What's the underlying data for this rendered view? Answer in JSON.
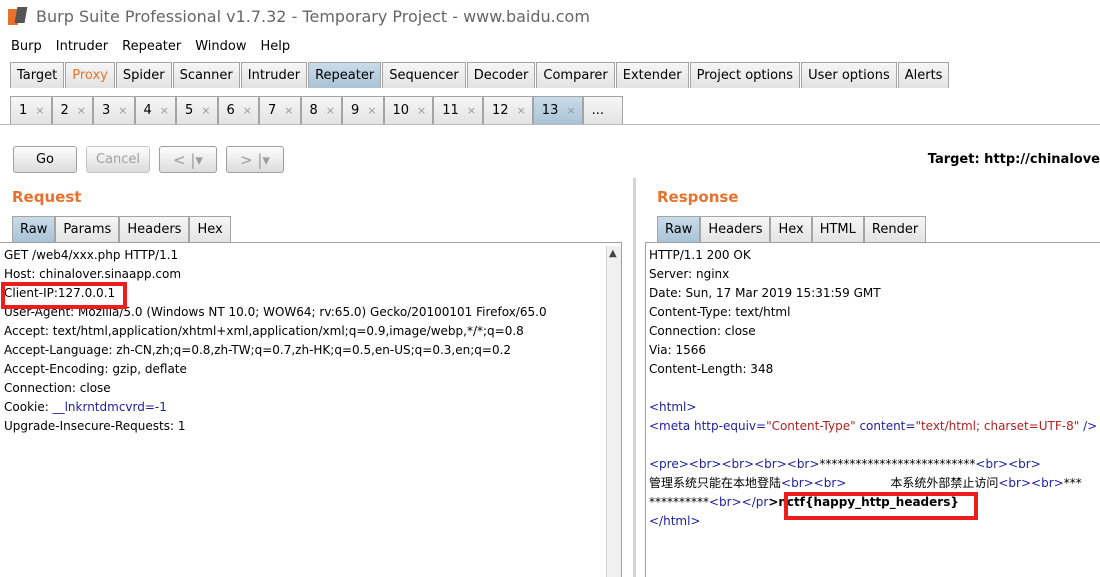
{
  "window": {
    "title": "Burp Suite Professional v1.7.32 - Temporary Project - www.baidu.com"
  },
  "menu": [
    "Burp",
    "Intruder",
    "Repeater",
    "Window",
    "Help"
  ],
  "main_tabs": [
    "Target",
    "Proxy",
    "Spider",
    "Scanner",
    "Intruder",
    "Repeater",
    "Sequencer",
    "Decoder",
    "Comparer",
    "Extender",
    "Project options",
    "User options",
    "Alerts"
  ],
  "repeater_tabs": [
    "1",
    "2",
    "3",
    "4",
    "5",
    "6",
    "7",
    "8",
    "9",
    "10",
    "11",
    "12",
    "13",
    "..."
  ],
  "tab_close": "×",
  "toolbar": {
    "go_label": "Go",
    "cancel_label": "Cancel",
    "back_label": "< |▾",
    "forward_label": "> |▾",
    "target": "Target: http://chinalove"
  },
  "request": {
    "title": "Request",
    "tabs": [
      "Raw",
      "Params",
      "Headers",
      "Hex"
    ],
    "lines": [
      "GET /web4/xxx.php HTTP/1.1",
      "Host: chinalover.sinaapp.com",
      "Client-IP:127.0.0.1",
      "User-Agent: Mozilla/5.0 (Windows NT 10.0; WOW64; rv:65.0) Gecko/20100101 Firefox/65.0",
      "Accept: text/html,application/xhtml+xml,application/xml;q=0.9,image/webp,*/*;q=0.8",
      "Accept-Language: zh-CN,zh;q=0.8,zh-TW;q=0.7,zh-HK;q=0.5,en-US;q=0.3,en;q=0.2",
      "Accept-Encoding: gzip, deflate",
      "Connection: close",
      "Upgrade-Insecure-Requests: 1"
    ],
    "cookie_label": "Cookie: ",
    "cookie_name": "__lnkrntdmcvrd",
    "cookie_value": "=-1"
  },
  "response": {
    "title": "Response",
    "tabs": [
      "Raw",
      "Headers",
      "Hex",
      "HTML",
      "Render"
    ],
    "headers": [
      "HTTP/1.1 200 OK",
      "Server: nginx",
      "Date: Sun, 17 Mar 2019 15:31:59 GMT",
      "Content-Type: text/html",
      "Connection: close",
      "Via: 1566",
      "Content-Length: 348"
    ],
    "body": {
      "html_open": "<html>",
      "meta_open": "<meta ",
      "meta_attr1": "http-equiv=",
      "meta_val1": "\"Content-Type\"",
      "meta_attr2": " content=",
      "meta_val2": "\"text/html; charset=UTF-8\"",
      "meta_close": " />",
      "pre_line_tags": "<pre><br><br><br><br>",
      "pre_line_stars": "**************************",
      "pre_line_end": "<br><br>",
      "cn_text1": "管理系统只能在本地登陆",
      "cn_br1": "<br><br>",
      "cn_text2": "本系统外部禁止访问",
      "cn_br2": "<br><br>",
      "cn_stars": "***",
      "stars_line": "**********",
      "stars_line_br": "<br></pr",
      "flag": ">nctf{happy_http_headers}",
      "html_close": "</html>"
    }
  }
}
